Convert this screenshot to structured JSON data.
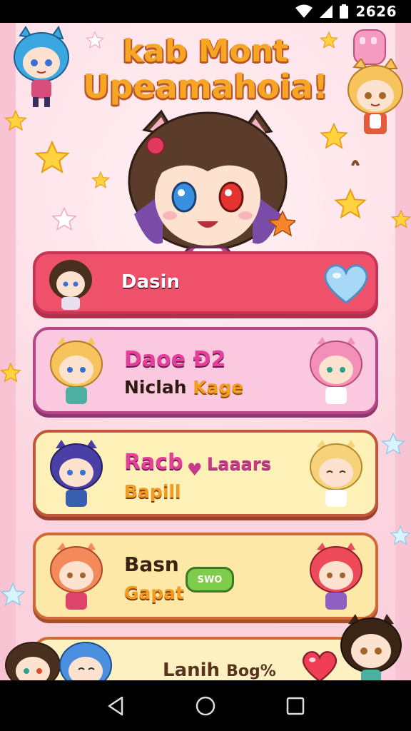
{
  "status_bar": {
    "time": "2626",
    "icons": [
      "wifi-icon",
      "signal-icon",
      "battery-icon"
    ]
  },
  "app": {
    "title_line1": "kab Mont",
    "title_line2": "Upeamahoia!",
    "colors": {
      "title": "#f7a524",
      "background": "#fde0e8",
      "card_red": "#f0516a",
      "card_pink": "#fbc9df",
      "card_yellow": "#fdf1b8"
    }
  },
  "cards": [
    {
      "primary": "Dasin",
      "icon": "heart-icon"
    },
    {
      "primary": "Daoe Ð2",
      "secondary_a": "Niclah ",
      "secondary_b": "Kage"
    },
    {
      "primary": "Racb",
      "connector": "♥",
      "tertiary": "Laaars",
      "secondary": "Bapill"
    },
    {
      "primary": "Basn",
      "secondary": "Gapat",
      "badge": "SWO"
    },
    {
      "primary": "Lanih",
      "tertiary": "Bog%",
      "icon": "heart-icon"
    }
  ],
  "nav": {
    "items": [
      "back-icon",
      "home-icon",
      "recents-icon"
    ]
  }
}
